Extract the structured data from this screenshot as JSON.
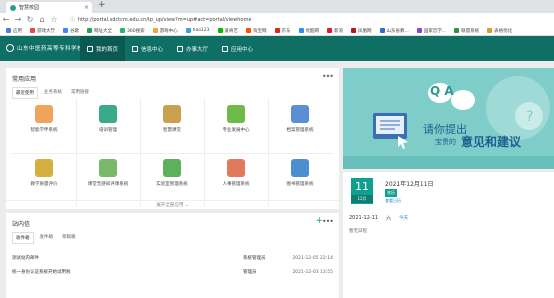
{
  "browser": {
    "tab_title": "智慧校园",
    "url": "http://portal.sdctcm.edu.cn/tp_up/view?m=up#act=portal/viewhome",
    "bookmarks": [
      {
        "label": "应用",
        "color": "#4a7fe0"
      },
      {
        "label": "游戏大厅",
        "color": "#e04a4a"
      },
      {
        "label": "谷歌",
        "color": "#4285f4"
      },
      {
        "label": "网址大全",
        "color": "#2a9d5a"
      },
      {
        "label": "360搜索",
        "color": "#28b46a"
      },
      {
        "label": "游戏中心",
        "color": "#f2a53b"
      },
      {
        "label": "hao123",
        "color": "#3aa0e0"
      },
      {
        "label": "爱奇艺",
        "color": "#00be06"
      },
      {
        "label": "淘宝网",
        "color": "#ff5000"
      },
      {
        "label": "京东",
        "color": "#e1251b"
      },
      {
        "label": "优酷网",
        "color": "#2b8ff0"
      },
      {
        "label": "新浪",
        "color": "#e6162d"
      },
      {
        "label": "凤凰网",
        "color": "#b5171d"
      },
      {
        "label": "山东省教...",
        "color": "#2d6fc9"
      },
      {
        "label": "国家哲学...",
        "color": "#7c4dd4"
      },
      {
        "label": "联盟系统",
        "color": "#3a8f3a"
      },
      {
        "label": "表格优化",
        "color": "#d4a02d"
      }
    ]
  },
  "header": {
    "school_name": "山东中医药高等专科学校",
    "nav": [
      {
        "label": "我的首页",
        "active": true
      },
      {
        "label": "信息中心",
        "active": false
      },
      {
        "label": "办事大厅",
        "active": false
      },
      {
        "label": "应用中心",
        "active": false
      }
    ]
  },
  "apps": {
    "title": "常用应用",
    "more": "•••",
    "subtabs": [
      {
        "label": "最近使用",
        "active": true
      },
      {
        "label": "业务系统",
        "active": false
      },
      {
        "label": "常用链接",
        "active": false
      }
    ],
    "items": [
      {
        "label": "智能学伴系统",
        "color": "#f0a35a"
      },
      {
        "label": "培训管理",
        "color": "#3aaa8a"
      },
      {
        "label": "智慧课堂",
        "color": "#c8a050"
      },
      {
        "label": "专业发展中心",
        "color": "#6fba4a"
      },
      {
        "label": "档案管理系统",
        "color": "#5a8fd4"
      },
      {
        "label": "教学质量评价",
        "color": "#d4b040"
      },
      {
        "label": "课堂无感知评课系统",
        "color": "#7ab86a"
      },
      {
        "label": "实验室管理系统",
        "color": "#5fb05a"
      },
      {
        "label": "人事管理系统",
        "color": "#e07a5a"
      },
      {
        "label": "图书管理系统",
        "color": "#4a8fd0"
      }
    ],
    "expand_label": "展开全部应用 ⌄"
  },
  "inbox": {
    "title": "站内信",
    "subtabs": [
      {
        "label": "收件箱",
        "active": true
      },
      {
        "label": "发件箱",
        "active": false
      },
      {
        "label": "草稿箱",
        "active": false
      }
    ],
    "messages": [
      {
        "subject": "测试站内邮件",
        "from": "系统管理员",
        "time": "2021-12-05 22:14"
      },
      {
        "subject": "统一身份认证系统开始试用啦",
        "from": "管理员",
        "time": "2021-12-03 13:55"
      }
    ]
  },
  "banner": {
    "qa": "Q A",
    "line1": "请你提出",
    "line2_small": "宝贵的",
    "line2_big": "意见和建议"
  },
  "calendar": {
    "day": "11",
    "month": "12月",
    "date_text": "2021年12月11日",
    "badge": "农历",
    "link": "查看日历",
    "row_date": "2021-12-11",
    "row_weekday": "六",
    "today": "今天",
    "empty": "暂无日程"
  }
}
